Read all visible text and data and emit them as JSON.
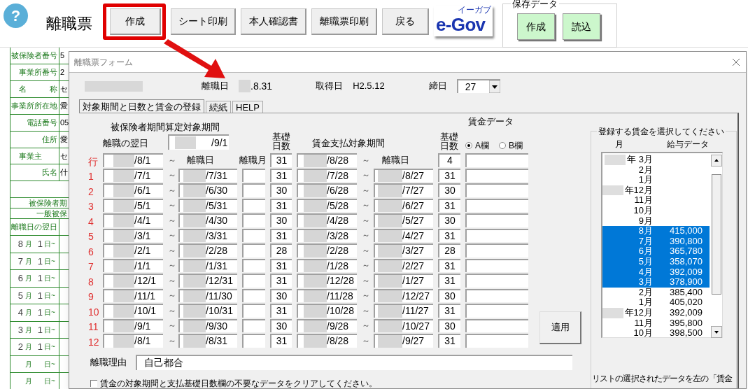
{
  "toolbar": {
    "help_icon": "?",
    "title": "離職票",
    "buttons": [
      {
        "label": "作成",
        "highlighted": true
      },
      {
        "label": "シート印刷",
        "highlighted": false
      },
      {
        "label": "本人確認書",
        "highlighted": false
      },
      {
        "label": "離職票印刷",
        "highlighted": false
      },
      {
        "label": "戻る",
        "highlighted": false
      }
    ],
    "logo": {
      "text": "e-Gov",
      "ruby": "イーガブ"
    },
    "save_group": {
      "title": "保存データ",
      "buttons": [
        "作成",
        "読込"
      ]
    }
  },
  "sheet": {
    "rows": [
      {
        "kind": "field",
        "label": "被保険者番号",
        "value": "5"
      },
      {
        "kind": "field",
        "label": "事業所番号",
        "value": "2"
      },
      {
        "kind": "field",
        "label": "名　　　称",
        "value": "セ"
      },
      {
        "kind": "field",
        "label": "事業所所在地",
        "value": "愛"
      },
      {
        "kind": "field",
        "label": "電話番号",
        "value": "05"
      },
      {
        "kind": "field",
        "label": "住所",
        "value": "愛"
      },
      {
        "kind": "group",
        "label": "事業主",
        "value": "セ"
      },
      {
        "kind": "field",
        "label": "氏名",
        "value": "什"
      },
      {
        "kind": "blank"
      },
      {
        "kind": "note",
        "label": "被保険者期"
      },
      {
        "kind": "note",
        "label": "一般被保"
      },
      {
        "kind": "field",
        "label": "離職日の翌日"
      },
      {
        "kind": "month",
        "month": "8",
        "month_unit": "月",
        "day": "1",
        "day_unit": "日~"
      },
      {
        "kind": "month",
        "month": "7",
        "month_unit": "月",
        "day": "1",
        "day_unit": "日~"
      },
      {
        "kind": "month",
        "month": "6",
        "month_unit": "月",
        "day": "1",
        "day_unit": "日~"
      },
      {
        "kind": "month",
        "month": "5",
        "month_unit": "月",
        "day": "1",
        "day_unit": "日~"
      },
      {
        "kind": "month",
        "month": "4",
        "month_unit": "月",
        "day": "1",
        "day_unit": "日~"
      },
      {
        "kind": "month",
        "month": "3",
        "month_unit": "月",
        "day": "1",
        "day_unit": "日~"
      },
      {
        "kind": "month",
        "month": "2",
        "month_unit": "月",
        "day": "1",
        "day_unit": "日~"
      },
      {
        "kind": "month",
        "month_unit": "月",
        "day_unit": "日~"
      },
      {
        "kind": "month",
        "month_unit": "月",
        "day_unit": "日~"
      }
    ]
  },
  "dialog": {
    "title": "離職票フォーム",
    "header": {
      "leave_date_label": "離職日",
      "leave_date": ".8.31",
      "acquired_label": "取得日",
      "acquired": "H2.5.12",
      "closing_label": "締日",
      "closing": "27"
    },
    "tabs": [
      {
        "label": "対象期間と日数と賃金の登録",
        "selected": true
      },
      {
        "label": "続紙",
        "selected": false
      },
      {
        "label": "HELP",
        "selected": false
      }
    ],
    "period": {
      "title": "被保険者期間算定対象期間",
      "next_day_label": "離職の翌日",
      "next_day": "/9/1",
      "days_header": "基礎日数",
      "wage_period_title": "賃金支払対象期間",
      "wage_days_header": "基礎日数",
      "wage_data_title": "賃金データ",
      "radios": [
        {
          "label": "A欄",
          "selected": true
        },
        {
          "label": "B欄",
          "selected": false
        }
      ]
    },
    "rows": [
      {
        "label": "行",
        "start": "/8/1",
        "sep": "～",
        "end_label": "離職日",
        "month_label": "離職月",
        "days": "31",
        "wage_start": "/8/28",
        "wage_sep": "～",
        "wage_end_label": "離職日",
        "wage_days": "4"
      },
      {
        "label": "1",
        "start": "/7/1",
        "sep": "～",
        "end": "/7/31",
        "days": "31",
        "wage_start": "/7/28",
        "wage_sep": "～",
        "wage_end": "/8/27",
        "wage_days": "31"
      },
      {
        "label": "2",
        "start": "/6/1",
        "sep": "～",
        "end": "/6/30",
        "days": "30",
        "wage_start": "/6/28",
        "wage_sep": "～",
        "wage_end": "/7/27",
        "wage_days": "30"
      },
      {
        "label": "3",
        "start": "/5/1",
        "sep": "～",
        "end": "/5/31",
        "days": "31",
        "wage_start": "/5/28",
        "wage_sep": "～",
        "wage_end": "/6/27",
        "wage_days": "31"
      },
      {
        "label": "4",
        "start": "/4/1",
        "sep": "～",
        "end": "/4/30",
        "days": "30",
        "wage_start": "/4/28",
        "wage_sep": "～",
        "wage_end": "/5/27",
        "wage_days": "30"
      },
      {
        "label": "5",
        "start": "/3/1",
        "sep": "～",
        "end": "/3/31",
        "days": "31",
        "wage_start": "/3/28",
        "wage_sep": "～",
        "wage_end": "/4/27",
        "wage_days": "31"
      },
      {
        "label": "6",
        "start": "/2/1",
        "sep": "～",
        "end": "/2/28",
        "days": "28",
        "wage_start": "/2/28",
        "wage_sep": "～",
        "wage_end": "/3/27",
        "wage_days": "28"
      },
      {
        "label": "7",
        "start": "/1/1",
        "sep": "～",
        "end": "/1/31",
        "days": "31",
        "wage_start": "/1/28",
        "wage_sep": "～",
        "wage_end": "/2/27",
        "wage_days": "31"
      },
      {
        "label": "8",
        "start": "/12/1",
        "sep": "～",
        "end": "/12/31",
        "days": "31",
        "wage_start": "/12/28",
        "wage_sep": "～",
        "wage_end": "/1/27",
        "wage_days": "31"
      },
      {
        "label": "9",
        "start": "/11/1",
        "sep": "～",
        "end": "/11/30",
        "days": "30",
        "wage_start": "/11/28",
        "wage_sep": "～",
        "wage_end": "/12/27",
        "wage_days": "30"
      },
      {
        "label": "10",
        "start": "/10/1",
        "sep": "～",
        "end": "/10/31",
        "days": "31",
        "wage_start": "/10/28",
        "wage_sep": "～",
        "wage_end": "/11/27",
        "wage_days": "31"
      },
      {
        "label": "11",
        "start": "/9/1",
        "sep": "～",
        "end": "/9/30",
        "days": "30",
        "wage_start": "/9/28",
        "wage_sep": "～",
        "wage_end": "/10/27",
        "wage_days": "30"
      },
      {
        "label": "12",
        "start": "/8/1",
        "sep": "～",
        "end": "/8/31",
        "days": "31",
        "wage_start": "/8/28",
        "wage_sep": "～",
        "wage_end": "/9/27",
        "wage_days": "31"
      }
    ],
    "apply_button": "適用",
    "reason_label": "離職理由",
    "reason": "自己都合",
    "clear_option": {
      "label": "賃金の対象期間と支払基礎日数欄の不要なデータをクリアしてください。",
      "checked": false
    },
    "wage_select": {
      "title": "登録する賃金を選択してください",
      "columns": [
        "月",
        "給与データ"
      ],
      "items": [
        {
          "month": "年 3月",
          "blurred": true,
          "selected": false
        },
        {
          "month": "2月",
          "blurred": false,
          "selected": false
        },
        {
          "month": "1月",
          "blurred": false,
          "selected": false
        },
        {
          "month": "年12月",
          "blurred": true,
          "selected": false
        },
        {
          "month": "11月",
          "blurred": false,
          "selected": false
        },
        {
          "month": "10月",
          "blurred": false,
          "selected": false
        },
        {
          "month": "9月",
          "blurred": false,
          "selected": false
        },
        {
          "month": "8月",
          "amount": "415,000",
          "blurred": false,
          "selected": true
        },
        {
          "month": "7月",
          "amount": "390,800",
          "blurred": false,
          "selected": true
        },
        {
          "month": "6月",
          "amount": "365,780",
          "blurred": false,
          "selected": true
        },
        {
          "month": "5月",
          "amount": "358,070",
          "blurred": false,
          "selected": true
        },
        {
          "month": "4月",
          "amount": "392,009",
          "blurred": false,
          "selected": true
        },
        {
          "month": "3月",
          "amount": "378,900",
          "blurred": false,
          "selected": true
        },
        {
          "month": "2月",
          "amount": "385,400",
          "blurred": false,
          "selected": false
        },
        {
          "month": "1月",
          "amount": "405,020",
          "blurred": false,
          "selected": false
        },
        {
          "month": "年12月",
          "amount": "392,009",
          "blurred": true,
          "selected": false
        },
        {
          "month": "11月",
          "amount": "395,800",
          "blurred": false,
          "selected": false
        },
        {
          "month": "10月",
          "amount": "398,500",
          "blurred": false,
          "selected": false
        }
      ],
      "note": "リストの選択されたデータを左の「賃金"
    }
  }
}
